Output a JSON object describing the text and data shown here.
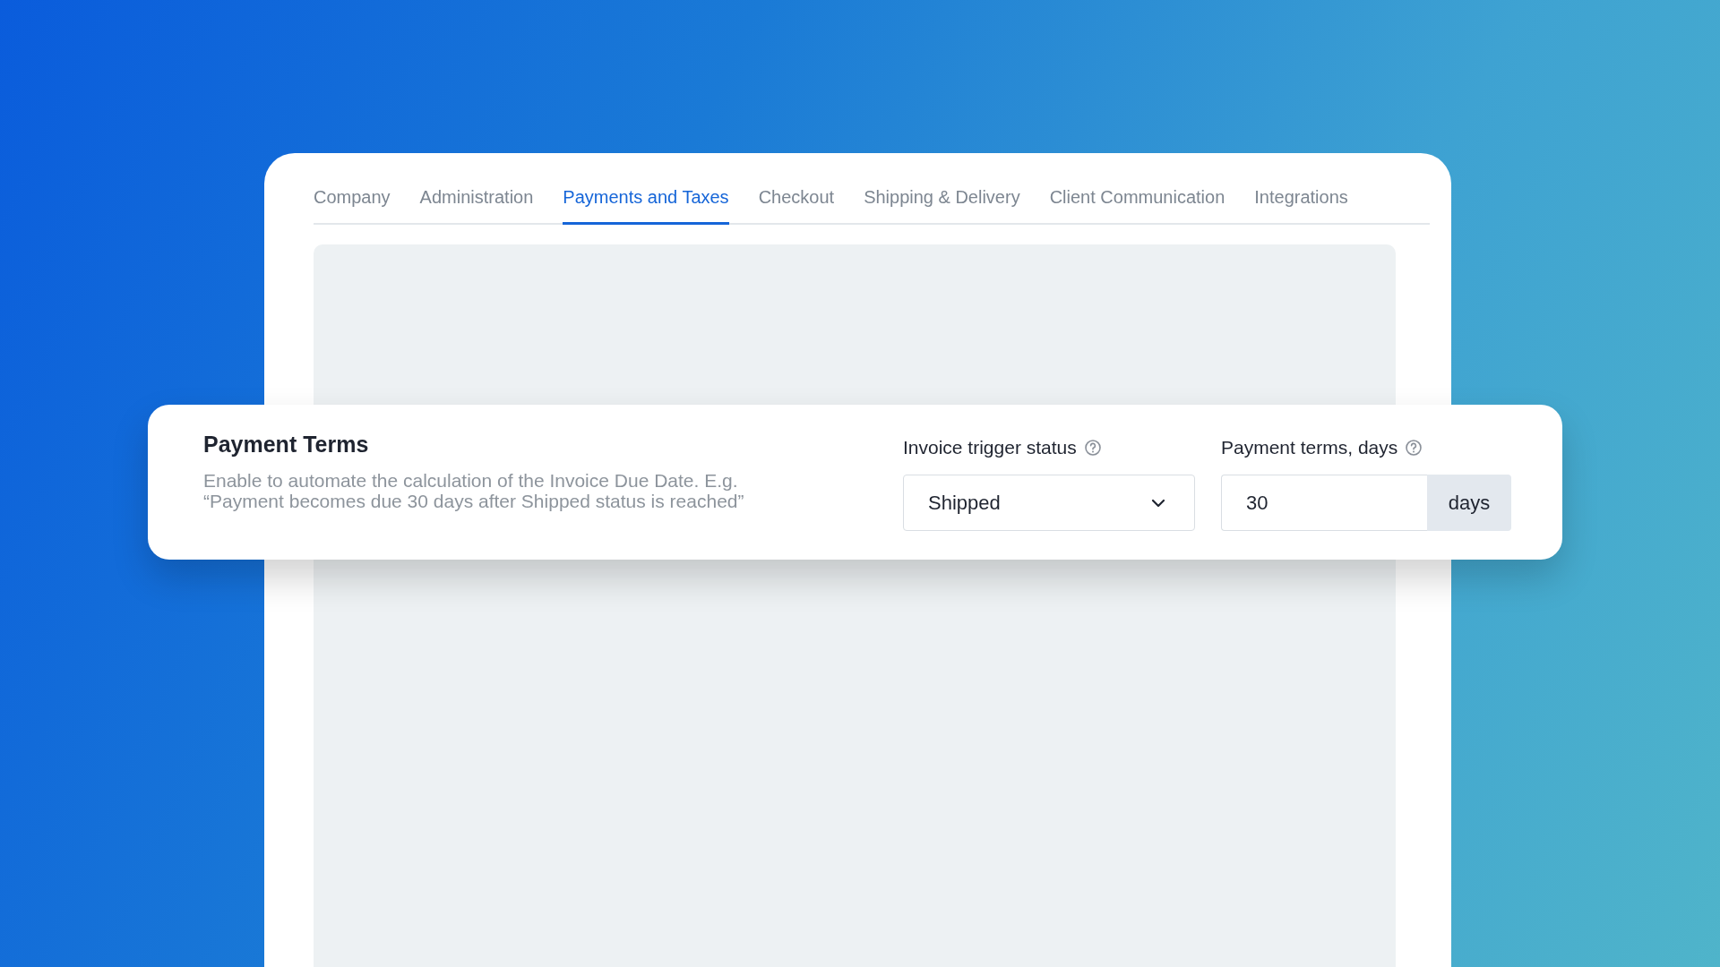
{
  "tabs": [
    {
      "label": "Company",
      "selected": false
    },
    {
      "label": "Administration",
      "selected": false
    },
    {
      "label": "Payments and Taxes",
      "selected": true
    },
    {
      "label": "Checkout",
      "selected": false
    },
    {
      "label": "Shipping & Delivery",
      "selected": false
    },
    {
      "label": "Client Communication",
      "selected": false
    },
    {
      "label": "Integrations",
      "selected": false
    }
  ],
  "payment_terms": {
    "title": "Payment Terms",
    "description": "Enable to automate the calculation of the Invoice Due Date. E.g. “Payment becomes due 30 days after Shipped status is reached”",
    "trigger_field": {
      "label": "Invoice trigger status",
      "value": "Shipped"
    },
    "terms_field": {
      "label": "Payment terms, days",
      "value": "30",
      "suffix": "days"
    }
  }
}
